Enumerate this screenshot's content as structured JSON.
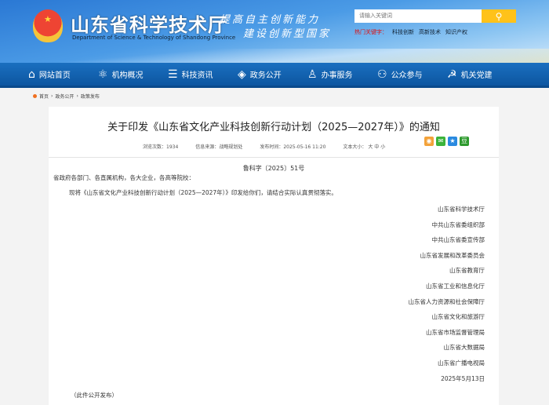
{
  "header": {
    "site_title": "山东省科学技术厅",
    "site_en": "Department of Science & Technology of Shandong Province",
    "slogan1": "提高自主创新能力",
    "slogan2": "建设创新型国家",
    "search_placeholder": "请输入关键词",
    "search_icon": "search-icon",
    "hot_label": "热门关键字：",
    "hot": [
      "科技创新",
      "高新技术",
      "知识产权"
    ]
  },
  "nav": [
    {
      "label": "网站首页",
      "icon": "⌂"
    },
    {
      "label": "机构概况",
      "icon": "⚛"
    },
    {
      "label": "科技资讯",
      "icon": "☰"
    },
    {
      "label": "政务公开",
      "icon": "◈"
    },
    {
      "label": "办事服务",
      "icon": "♙"
    },
    {
      "label": "公众参与",
      "icon": "⚇"
    },
    {
      "label": "机关党建",
      "icon": "☭"
    }
  ],
  "breadcrumb": [
    "首页",
    "政务公开",
    "政策发布"
  ],
  "article": {
    "title": "关于印发《山东省文化产业科技创新行动计划（2025—2027年）》的通知",
    "views_label": "浏览次数：",
    "views": "1934",
    "source_label": "信息来源：",
    "source": "战略规划处",
    "time_label": "发布时间：",
    "time": "2025-05-16 11:20",
    "size_label": "文本大小：",
    "size_big": "大",
    "size_mid": "中",
    "size_small": "小",
    "doc_no": "鲁科字〔2025〕51号",
    "salutation": "省政府各部门、各直属机构，各大企业，各高等院校：",
    "body": "现将《山东省文化产业科技创新行动计划（2025—2027年）》印发给你们，请结合实际认真贯彻落实。",
    "signatories": [
      "山东省科学技术厅",
      "中共山东省委组织部",
      "中共山东省委宣传部",
      "山东省发展和改革委员会",
      "山东省教育厅",
      "山东省工业和信息化厅",
      "山东省人力资源和社会保障厅",
      "山东省文化和旅游厅",
      "山东省市场监督管理局",
      "山东省大数据局",
      "山东省广播电视局"
    ],
    "date": "2025年5月13日",
    "note": "（此件公开发布）"
  },
  "share": [
    {
      "name": "weibo",
      "color": "#f3a23a",
      "glyph": "◉"
    },
    {
      "name": "wechat",
      "color": "#3bb33b",
      "glyph": "✉"
    },
    {
      "name": "qzone",
      "color": "#2a8ae0",
      "glyph": "★"
    },
    {
      "name": "douban",
      "color": "#2d9a2d",
      "glyph": "豆"
    }
  ]
}
